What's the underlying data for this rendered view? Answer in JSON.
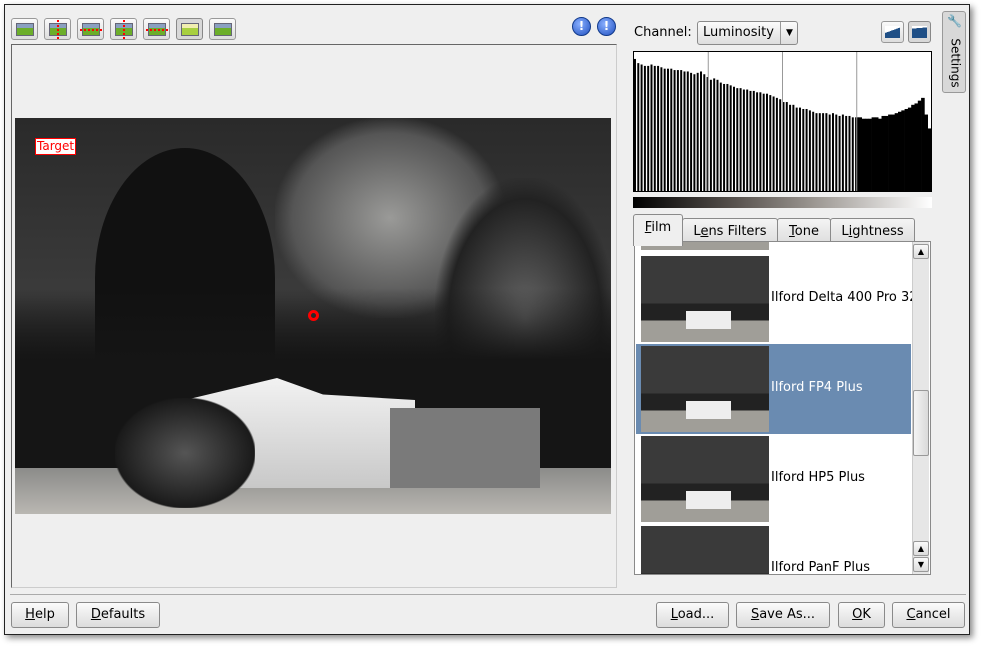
{
  "toolbar": {
    "buttons": [
      {
        "name": "original-preview",
        "icon": "landscape-icon"
      },
      {
        "name": "split-vertical",
        "icon": "split-vertical-icon"
      },
      {
        "name": "split-horizontal",
        "icon": "split-horizontal-icon"
      },
      {
        "name": "split-vertical-duplicate",
        "icon": "split-vertical-duplicate-icon"
      },
      {
        "name": "split-horizontal-duplicate",
        "icon": "split-horizontal-duplicate-icon"
      },
      {
        "name": "target-preview",
        "icon": "target-image-icon",
        "active": true
      },
      {
        "name": "mouse-over",
        "icon": "cursor-over-image-icon"
      }
    ],
    "underexposure_label": "!",
    "overexposure_label": "!"
  },
  "preview": {
    "target_label": "Target"
  },
  "channel": {
    "label": "Channel:",
    "selected": "Luminosity"
  },
  "histogram": {
    "values": [
      95,
      92,
      91,
      90,
      90,
      91,
      90,
      90,
      89,
      88,
      88,
      88,
      87,
      87,
      87,
      86,
      86,
      85,
      84,
      85,
      86,
      84,
      82,
      80,
      81,
      80,
      78,
      77,
      77,
      76,
      75,
      74,
      74,
      73,
      73,
      72,
      72,
      71,
      71,
      70,
      70,
      69,
      68,
      67,
      66,
      64,
      64,
      62,
      62,
      60,
      60,
      59,
      59,
      58,
      57,
      56,
      56,
      56,
      56,
      55,
      56,
      55,
      54,
      55,
      54,
      54,
      53,
      53,
      53,
      52,
      52,
      52,
      53,
      53,
      52,
      54,
      54,
      55,
      55,
      56,
      57,
      58,
      59,
      60,
      62,
      63,
      65,
      67,
      55,
      45
    ],
    "gridlines": 4
  },
  "tabs": [
    {
      "label": "Film",
      "mnemonic": "F",
      "active": true
    },
    {
      "label": "Lens Filters",
      "mnemonic": "e"
    },
    {
      "label": "Tone",
      "mnemonic": "T"
    },
    {
      "label": "Lightness",
      "mnemonic": "i"
    }
  ],
  "film_list": [
    {
      "label": "Ilford Delta 400 Pro 32"
    },
    {
      "label": "Ilford FP4 Plus",
      "selected": true
    },
    {
      "label": "Ilford HP5 Plus"
    },
    {
      "label": "Ilford PanF Plus"
    }
  ],
  "settings_tab": "Settings",
  "buttons": {
    "help": "Help",
    "defaults": "Defaults",
    "load": "Load...",
    "save_as": "Save As...",
    "ok": "OK",
    "cancel": "Cancel"
  },
  "colors": {
    "selection": "#6a8bb1",
    "target_label": "#ff0000"
  }
}
